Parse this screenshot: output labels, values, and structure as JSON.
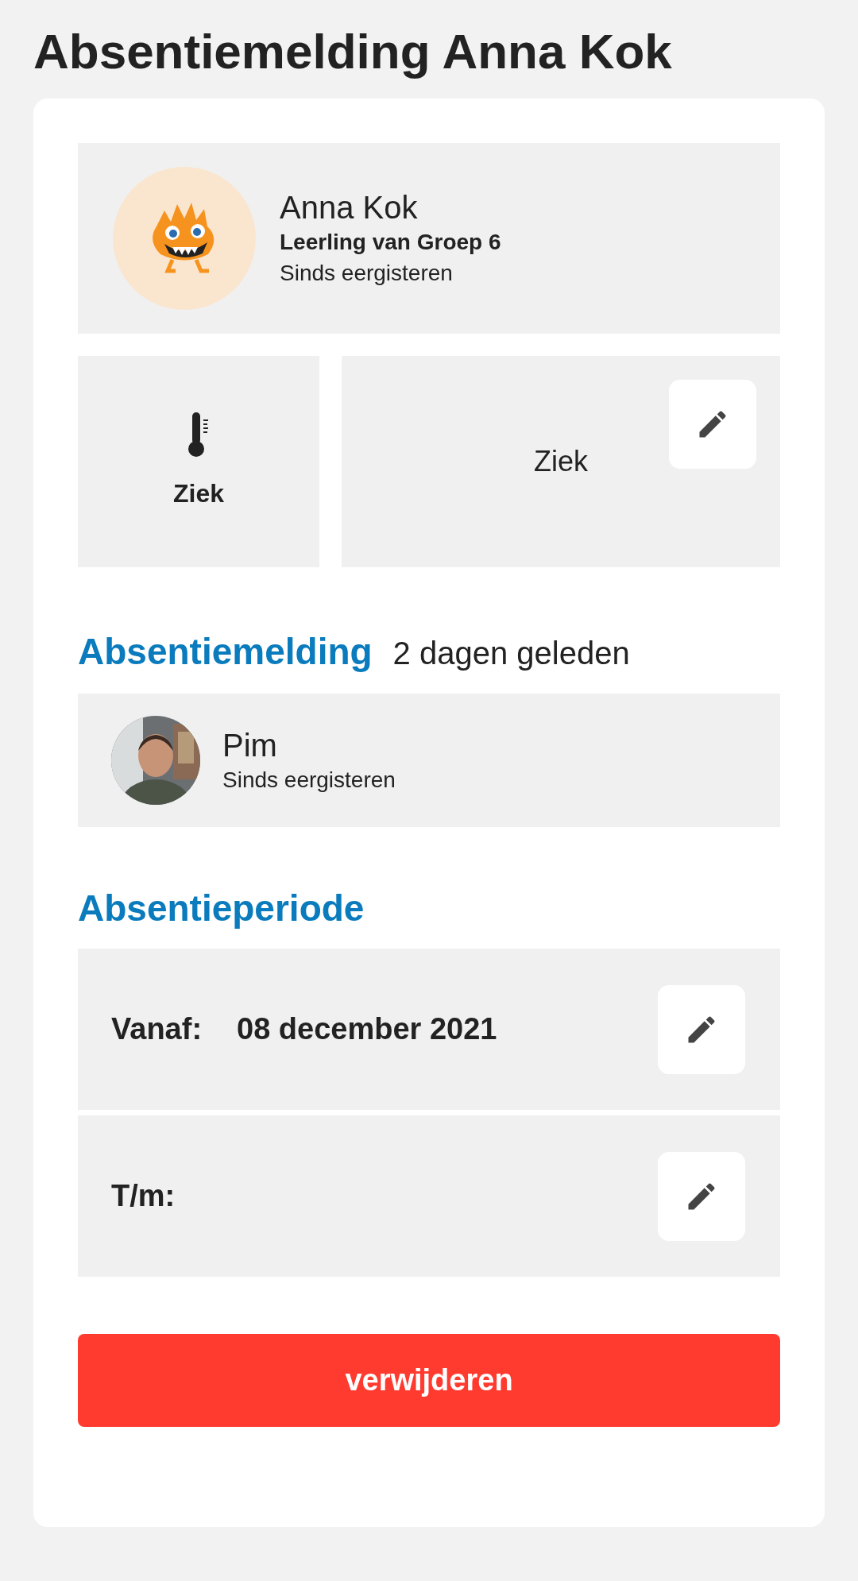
{
  "title": "Absentiemelding Anna Kok",
  "student": {
    "name": "Anna Kok",
    "group": "Leerling van Groep 6",
    "since": "Sinds eergisteren"
  },
  "reason": {
    "label": "Ziek",
    "value": "Ziek"
  },
  "report": {
    "heading": "Absentiemelding",
    "age": "2 dagen geleden",
    "reporter": {
      "name": "Pim",
      "since": "Sinds eergisteren"
    }
  },
  "period": {
    "heading": "Absentieperiode",
    "rows": [
      {
        "label": "Vanaf:",
        "value": "08 december 2021"
      },
      {
        "label": "T/m:"
      }
    ]
  },
  "delete_button": "verwijderen"
}
